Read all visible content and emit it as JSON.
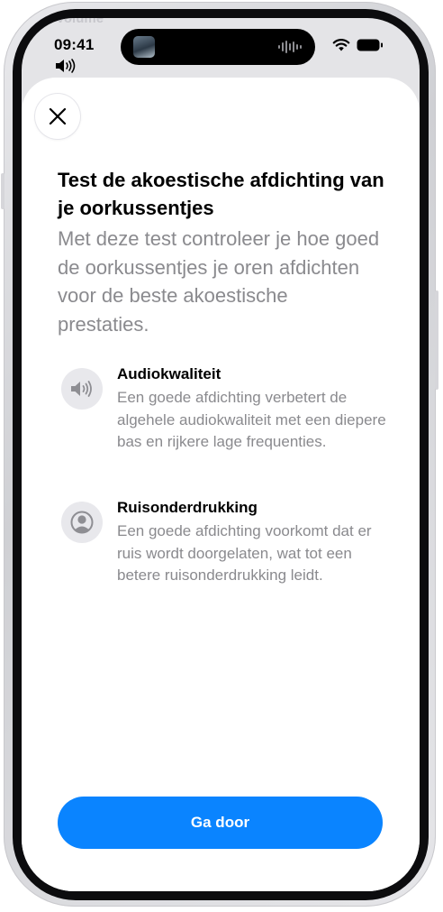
{
  "status_bar": {
    "time": "09:41",
    "volume_ghost": "Volume"
  },
  "sheet": {
    "close_label": "Sluiten",
    "title": "Test de akoestische afdichting van je oorkussentjes",
    "subtitle": "Met deze test controleer je hoe goed de oorkussentjes je oren afdichten voor de beste akoestische prestaties.",
    "features": [
      {
        "icon": "speaker-wave-icon",
        "title": "Audiokwaliteit",
        "description": "Een goede afdichting verbetert de algehele audiokwaliteit met een diepere bas en rijkere lage frequenties."
      },
      {
        "icon": "noise-cancellation-icon",
        "title": "Ruisonderdrukking",
        "description": "Een goede afdichting voorkomt dat er ruis wordt doorgelaten, wat tot een betere ruisonderdrukking leidt."
      }
    ],
    "continue_label": "Ga door"
  },
  "colors": {
    "accent": "#0a84ff",
    "secondary_text": "#8a8a8e",
    "icon_circle": "#e8e8ec"
  }
}
